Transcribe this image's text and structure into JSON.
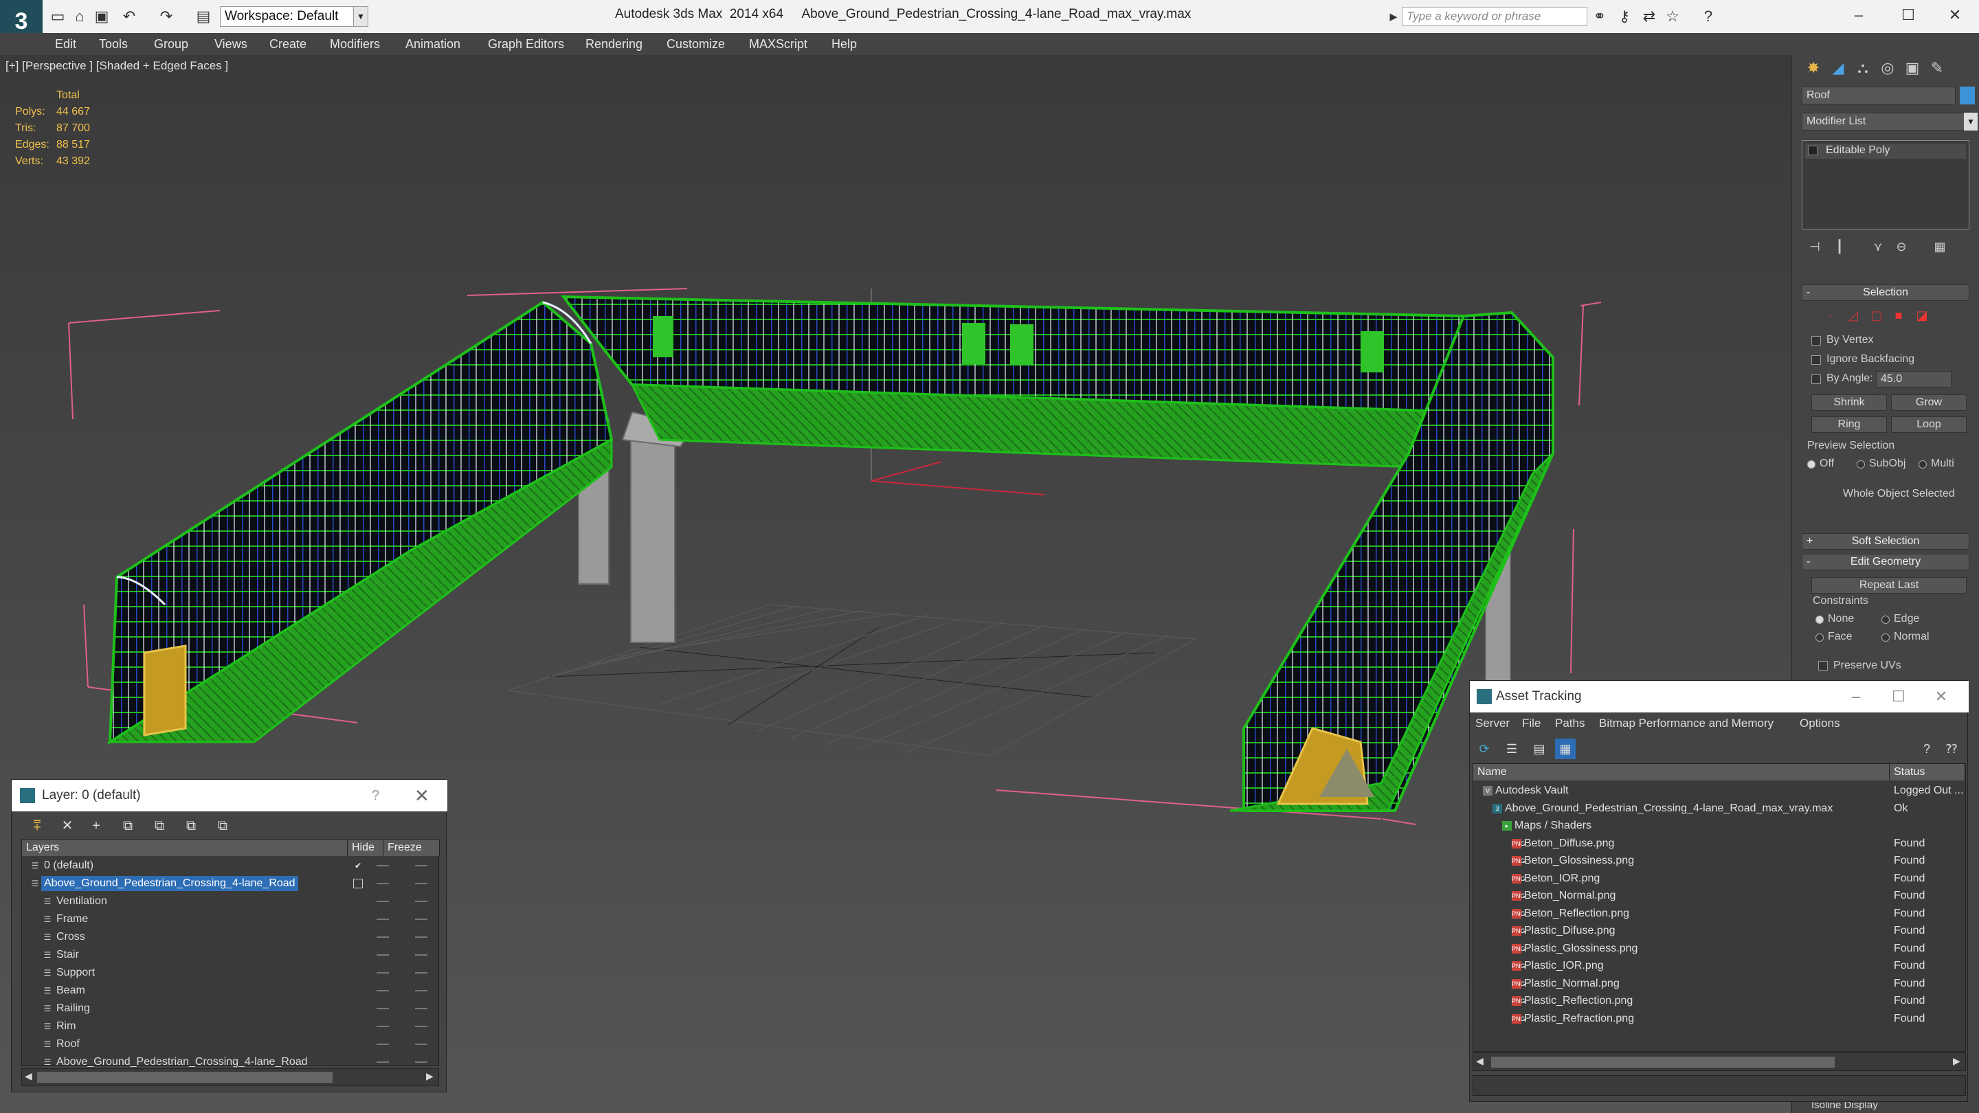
{
  "titlebar": {
    "workspace": "Workspace: Default",
    "app_name": "Autodesk 3ds Max  2014 x64",
    "file_name": "Above_Ground_Pedestrian_Crossing_4-lane_Road_max_vray.max",
    "search_placeholder": "Type a keyword or phrase"
  },
  "menu": [
    "Edit",
    "Tools",
    "Group",
    "Views",
    "Create",
    "Modifiers",
    "Animation",
    "Graph Editors",
    "Rendering",
    "Customize",
    "MAXScript",
    "Help"
  ],
  "viewport": {
    "label": "[+] [Perspective ] [Shaded + Edged Faces ]",
    "stats_header": "Total",
    "stats": [
      {
        "label": "Polys:",
        "value": "44 667"
      },
      {
        "label": "Tris:",
        "value": "87 700"
      },
      {
        "label": "Edges:",
        "value": "88 517"
      },
      {
        "label": "Verts:",
        "value": "43 392"
      }
    ]
  },
  "command_panel": {
    "object_name": "Roof",
    "object_color": "#3e92d6",
    "modifier_list": "Modifier List",
    "modifier_stack_item": "Editable Poly",
    "selection": {
      "title": "Selection",
      "by_vertex": "By Vertex",
      "ignore_backfacing": "Ignore Backfacing",
      "by_angle": "By Angle:",
      "angle_value": "45.0",
      "shrink": "Shrink",
      "grow": "Grow",
      "ring": "Ring",
      "loop": "Loop",
      "preview_selection": "Preview Selection",
      "preview_off": "Off",
      "preview_subobj": "SubObj",
      "preview_multi": "Multi",
      "status": "Whole Object Selected"
    },
    "soft_selection": "Soft Selection",
    "edit_geometry": {
      "title": "Edit Geometry",
      "repeat_last": "Repeat Last",
      "constraints": "Constraints",
      "none": "None",
      "edge": "Edge",
      "face": "Face",
      "normal": "Normal",
      "preserve_uvs": "Preserve UVs"
    },
    "isoline": "Isoline Display"
  },
  "layer_dialog": {
    "title": "Layer: 0 (default)",
    "help": "?",
    "columns": {
      "layers": "Layers",
      "hide": "Hide",
      "freeze": "Freeze"
    },
    "rows": [
      {
        "name": "0 (default)",
        "level": 0,
        "active": true,
        "selected": false
      },
      {
        "name": "Above_Ground_Pedestrian_Crossing_4-lane_Road",
        "level": 0,
        "active": false,
        "selected": true
      },
      {
        "name": "Ventilation",
        "level": 1
      },
      {
        "name": "Frame",
        "level": 1
      },
      {
        "name": "Cross",
        "level": 1
      },
      {
        "name": "Stair",
        "level": 1
      },
      {
        "name": "Support",
        "level": 1
      },
      {
        "name": "Beam",
        "level": 1
      },
      {
        "name": "Railing",
        "level": 1
      },
      {
        "name": "Rim",
        "level": 1
      },
      {
        "name": "Roof",
        "level": 1
      },
      {
        "name": "Above_Ground_Pedestrian_Crossing_4-lane_Road",
        "level": 1
      }
    ]
  },
  "asset_tracking": {
    "title": "Asset Tracking",
    "menu": [
      "Server",
      "File",
      "Paths",
      "Bitmap Performance and Memory",
      "Options"
    ],
    "columns": {
      "name": "Name",
      "status": "Status"
    },
    "rows": [
      {
        "name": "Autodesk Vault",
        "status": "Logged Out ...",
        "level": 0,
        "icon": "vault"
      },
      {
        "name": "Above_Ground_Pedestrian_Crossing_4-lane_Road_max_vray.max",
        "status": "Ok",
        "level": 1,
        "icon": "max"
      },
      {
        "name": "Maps / Shaders",
        "status": "",
        "level": 2,
        "icon": "folder"
      },
      {
        "name": "Beton_Diffuse.png",
        "status": "Found",
        "level": 3,
        "icon": "png"
      },
      {
        "name": "Beton_Glossiness.png",
        "status": "Found",
        "level": 3,
        "icon": "png"
      },
      {
        "name": "Beton_IOR.png",
        "status": "Found",
        "level": 3,
        "icon": "png"
      },
      {
        "name": "Beton_Normal.png",
        "status": "Found",
        "level": 3,
        "icon": "png"
      },
      {
        "name": "Beton_Reflection.png",
        "status": "Found",
        "level": 3,
        "icon": "png"
      },
      {
        "name": "Plastic_Difuse.png",
        "status": "Found",
        "level": 3,
        "icon": "png"
      },
      {
        "name": "Plastic_Glossiness.png",
        "status": "Found",
        "level": 3,
        "icon": "png"
      },
      {
        "name": "Plastic_IOR.png",
        "status": "Found",
        "level": 3,
        "icon": "png"
      },
      {
        "name": "Plastic_Normal.png",
        "status": "Found",
        "level": 3,
        "icon": "png"
      },
      {
        "name": "Plastic_Reflection.png",
        "status": "Found",
        "level": 3,
        "icon": "png"
      },
      {
        "name": "Plastic_Refraction.png",
        "status": "Found",
        "level": 3,
        "icon": "png"
      }
    ]
  },
  "colors": {
    "accent_blue": "#2d6db5",
    "stats_yellow": "#f3c24c",
    "wire_green": "#22c41c",
    "bbox_pink": "#e0608a"
  }
}
